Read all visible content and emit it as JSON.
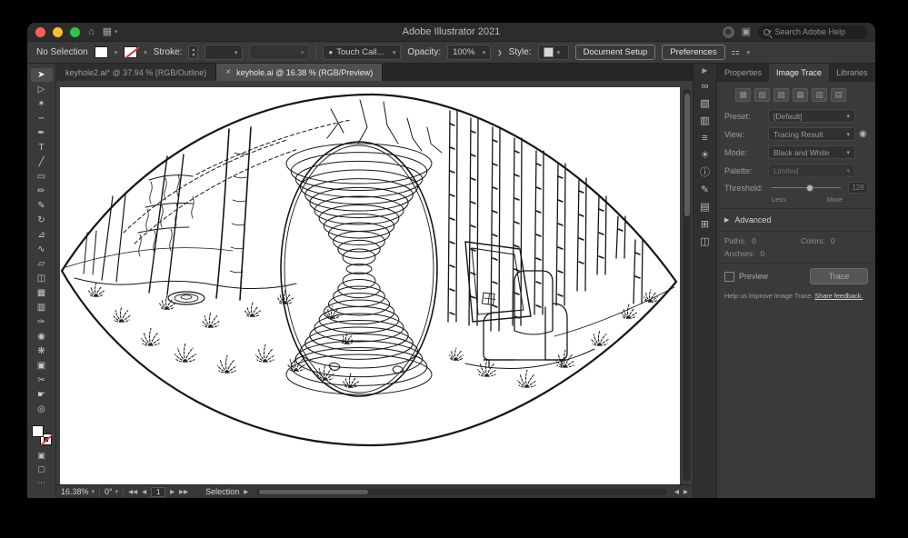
{
  "window": {
    "title": "Adobe Illustrator 2021",
    "search_placeholder": "Search Adobe Help"
  },
  "control_bar": {
    "selection_label": "No Selection",
    "stroke_label": "Stroke:",
    "brush_value": "Touch Call...",
    "opacity_label": "Opacity:",
    "opacity_value": "100%",
    "style_label": "Style:",
    "document_setup": "Document Setup",
    "preferences": "Preferences"
  },
  "tabs": [
    {
      "label": "keyhole2.ai* @ 37.94 % (RGB/Outline)",
      "active": false
    },
    {
      "label": "keyhole.ai @ 16.38 % (RGB/Preview)",
      "active": true
    }
  ],
  "tools": [
    {
      "name": "selection-tool",
      "glyph": "➤"
    },
    {
      "name": "direct-selection-tool",
      "glyph": "▷"
    },
    {
      "name": "magic-wand-tool",
      "glyph": "✶"
    },
    {
      "name": "lasso-tool",
      "glyph": "∽"
    },
    {
      "name": "pen-tool",
      "glyph": "✒"
    },
    {
      "name": "type-tool",
      "glyph": "T"
    },
    {
      "name": "line-segment-tool",
      "glyph": "╱"
    },
    {
      "name": "rectangle-tool",
      "glyph": "▭"
    },
    {
      "name": "paintbrush-tool",
      "glyph": "✏"
    },
    {
      "name": "pencil-tool",
      "glyph": "✎"
    },
    {
      "name": "rotate-tool",
      "glyph": "↻"
    },
    {
      "name": "scale-tool",
      "glyph": "⊿"
    },
    {
      "name": "width-tool",
      "glyph": "∿"
    },
    {
      "name": "free-transform-tool",
      "glyph": "▱"
    },
    {
      "name": "shape-builder-tool",
      "glyph": "◫"
    },
    {
      "name": "mesh-tool",
      "glyph": "▦"
    },
    {
      "name": "gradient-tool",
      "glyph": "▥"
    },
    {
      "name": "eyedropper-tool",
      "glyph": "✑"
    },
    {
      "name": "blend-tool",
      "glyph": "◉"
    },
    {
      "name": "symbol-sprayer-tool",
      "glyph": "❋"
    },
    {
      "name": "artboard-tool",
      "glyph": "▣"
    },
    {
      "name": "slice-tool",
      "glyph": "✂"
    },
    {
      "name": "hand-tool",
      "glyph": "☛"
    },
    {
      "name": "zoom-tool",
      "glyph": "◎"
    }
  ],
  "tool_modes": [
    {
      "name": "draw-normal-icon",
      "glyph": "▣"
    },
    {
      "name": "draw-behind-icon",
      "glyph": "▢"
    },
    {
      "name": "more-tools-icon",
      "glyph": "⋯"
    }
  ],
  "panel_strip_icons": [
    {
      "name": "collapse-panels-icon",
      "glyph": "▶"
    },
    {
      "name": "link-icon",
      "glyph": "∞"
    },
    {
      "name": "swatches-icon",
      "glyph": "▧"
    },
    {
      "name": "brushes-icon",
      "glyph": "▥"
    },
    {
      "name": "properties-panel-icon",
      "glyph": "≡"
    },
    {
      "name": "appearance-icon",
      "glyph": "☀"
    },
    {
      "name": "info-icon",
      "glyph": "ⓘ"
    },
    {
      "name": "comments-icon",
      "glyph": "✎"
    },
    {
      "name": "layers-icon",
      "glyph": "▤"
    },
    {
      "name": "artboards-icon",
      "glyph": "⊞"
    },
    {
      "name": "asset-export-icon",
      "glyph": "◫"
    }
  ],
  "preset_thumbs": [
    {
      "name": "preset-auto-color",
      "glyph": "▩"
    },
    {
      "name": "preset-high-color",
      "glyph": "▨"
    },
    {
      "name": "preset-low-color",
      "glyph": "▧"
    },
    {
      "name": "preset-grayscale",
      "glyph": "▦"
    },
    {
      "name": "preset-black-white",
      "glyph": "▥"
    },
    {
      "name": "preset-outline",
      "glyph": "▤"
    }
  ],
  "panel": {
    "tabs": [
      {
        "label": "Properties",
        "active": false
      },
      {
        "label": "Image Trace",
        "active": true
      },
      {
        "label": "Libraries",
        "active": false
      }
    ]
  },
  "image_trace": {
    "preset_label": "Preset:",
    "preset_value": "[Default]",
    "view_label": "View:",
    "view_value": "Tracing Result",
    "mode_label": "Mode:",
    "mode_value": "Black and White",
    "palette_label": "Palette:",
    "palette_value": "Limited",
    "threshold_label": "Threshold:",
    "threshold_value": "128",
    "threshold_less": "Less",
    "threshold_more": "More",
    "advanced_label": "Advanced",
    "paths_label": "Paths:",
    "paths_value": "0",
    "anchors_label": "Anchors:",
    "anchors_value": "0",
    "colors_label": "Colors:",
    "colors_value": "0",
    "preview_label": "Preview",
    "trace_button": "Trace",
    "help_text": "Help us improve Image Trace.",
    "feedback_link": "Share feedback."
  },
  "status_bar": {
    "zoom": "16.38%",
    "rotation": "0°",
    "artboard_number": "1",
    "tool_label": "Selection"
  },
  "colors": {
    "traffic_red": "#ff5f57",
    "traffic_yellow": "#febc2e",
    "traffic_green": "#28c840",
    "none_slash_red": "#d9363e"
  }
}
